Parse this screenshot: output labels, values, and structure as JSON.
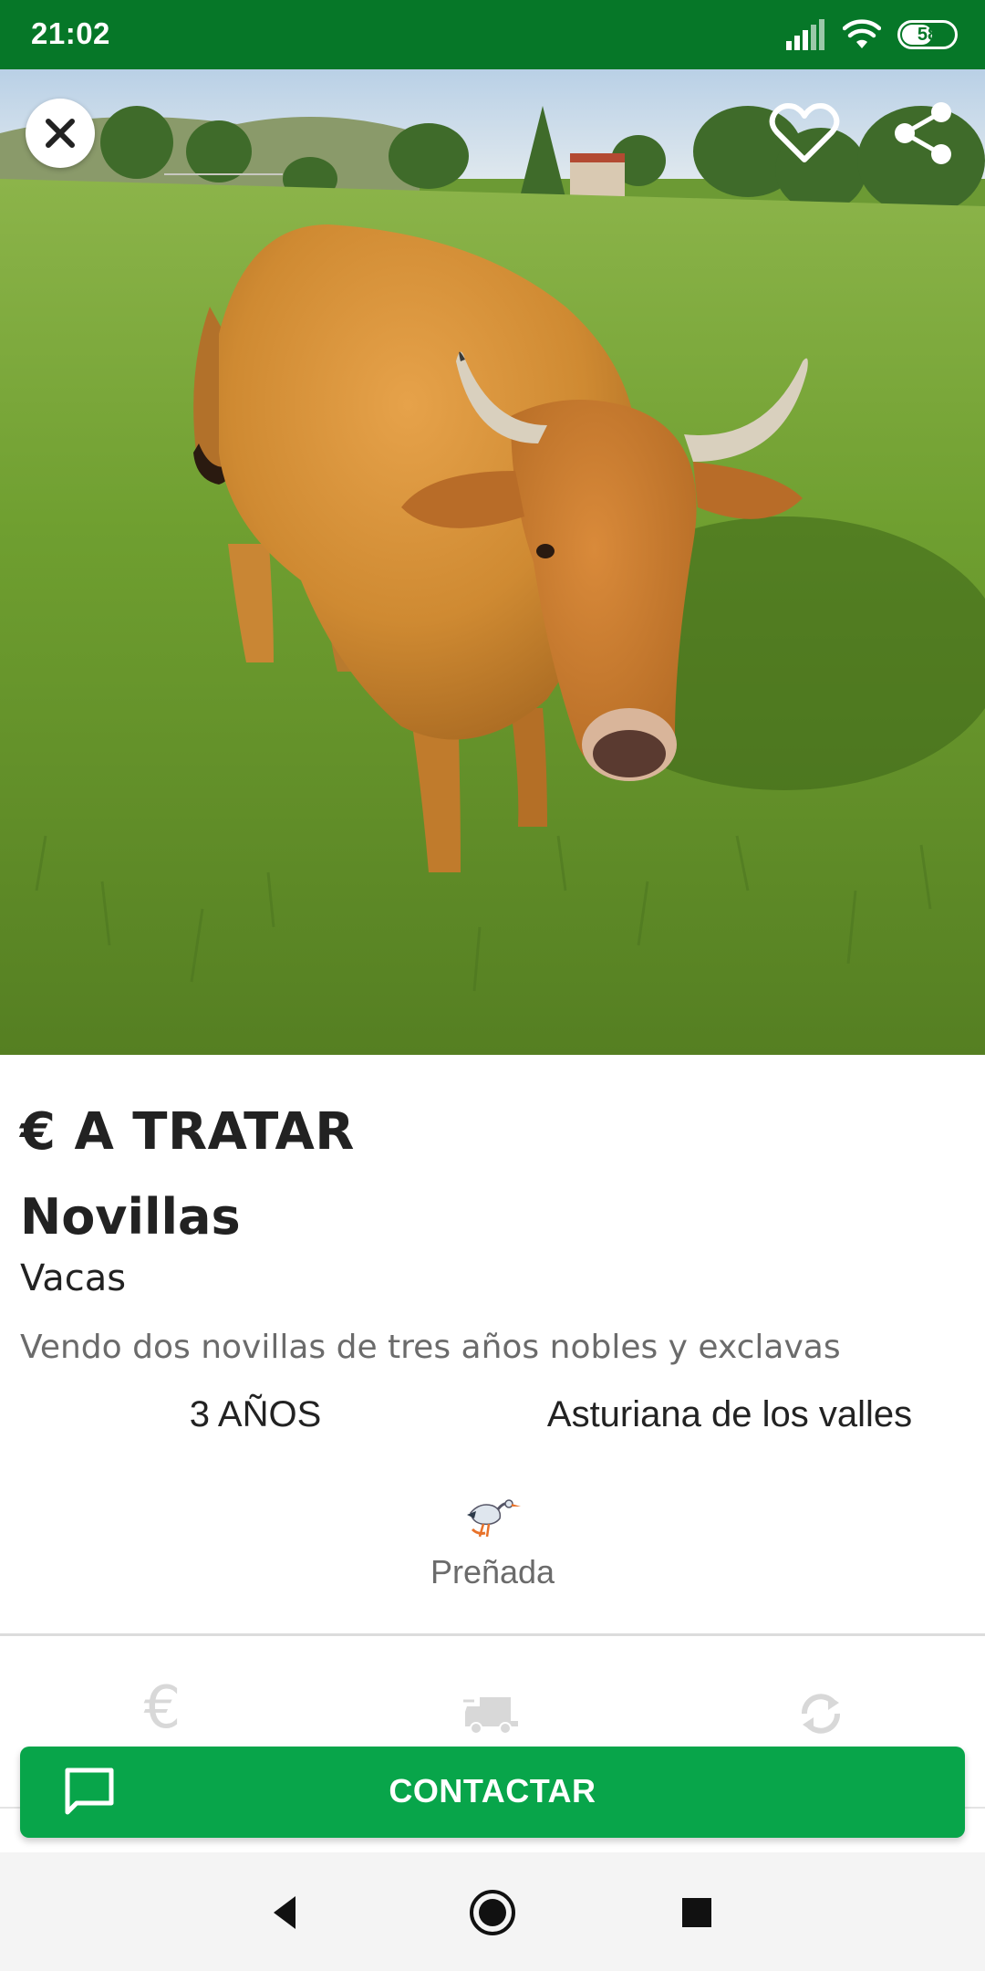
{
  "status_bar": {
    "time": "21:02",
    "battery": "58",
    "icons": [
      "signal-icon",
      "wifi-icon",
      "battery-icon"
    ],
    "background": "#067728"
  },
  "photo": {
    "subject": "cow-photo",
    "actions": [
      "close-icon",
      "heart-icon",
      "share-icon"
    ]
  },
  "listing": {
    "price": "€ A TRATAR",
    "title": "Novillas",
    "category": "Vacas",
    "description": "Vendo dos novillas de tres años nobles y exclavas",
    "age": "3 AÑOS",
    "breed": "Asturiana de los valles",
    "pregnant_label": "Preñada",
    "pregnant_icon": "stork-icon"
  },
  "features": {
    "icons": [
      "euro-icon",
      "truck-icon",
      "sync-icon"
    ]
  },
  "contact": {
    "label": "CONTACTAR",
    "icon": "chat-icon",
    "color": "#08a54a"
  },
  "nav": {
    "icons": [
      "back-icon",
      "home-icon",
      "recents-icon"
    ]
  }
}
